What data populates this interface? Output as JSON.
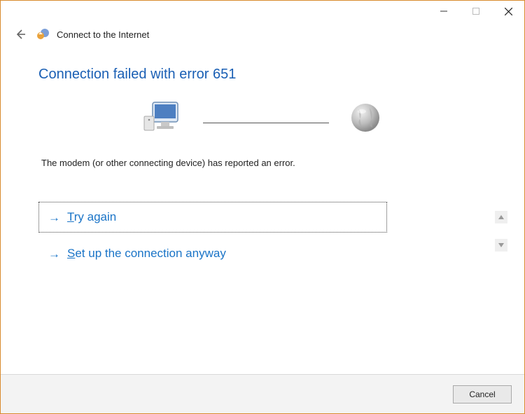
{
  "window": {
    "title": "Connect to the Internet"
  },
  "page": {
    "heading": "Connection failed with error 651",
    "error_message": "The modem (or other connecting device) has reported an error."
  },
  "options": {
    "try_again": {
      "arrow": "→",
      "accel": "T",
      "rest": "ry again"
    },
    "setup_anyway": {
      "arrow": "→",
      "accel": "S",
      "rest": "et up the connection anyway"
    }
  },
  "buttons": {
    "cancel": "Cancel"
  },
  "icons": {
    "back": "back-arrow-icon",
    "wizard": "network-wizard-icon",
    "computer": "computer-monitor-icon",
    "globe": "globe-icon",
    "minimize": "minimize-icon",
    "maximize": "maximize-icon",
    "close": "close-icon",
    "scroll_up": "scroll-up-icon",
    "scroll_down": "scroll-down-icon"
  }
}
